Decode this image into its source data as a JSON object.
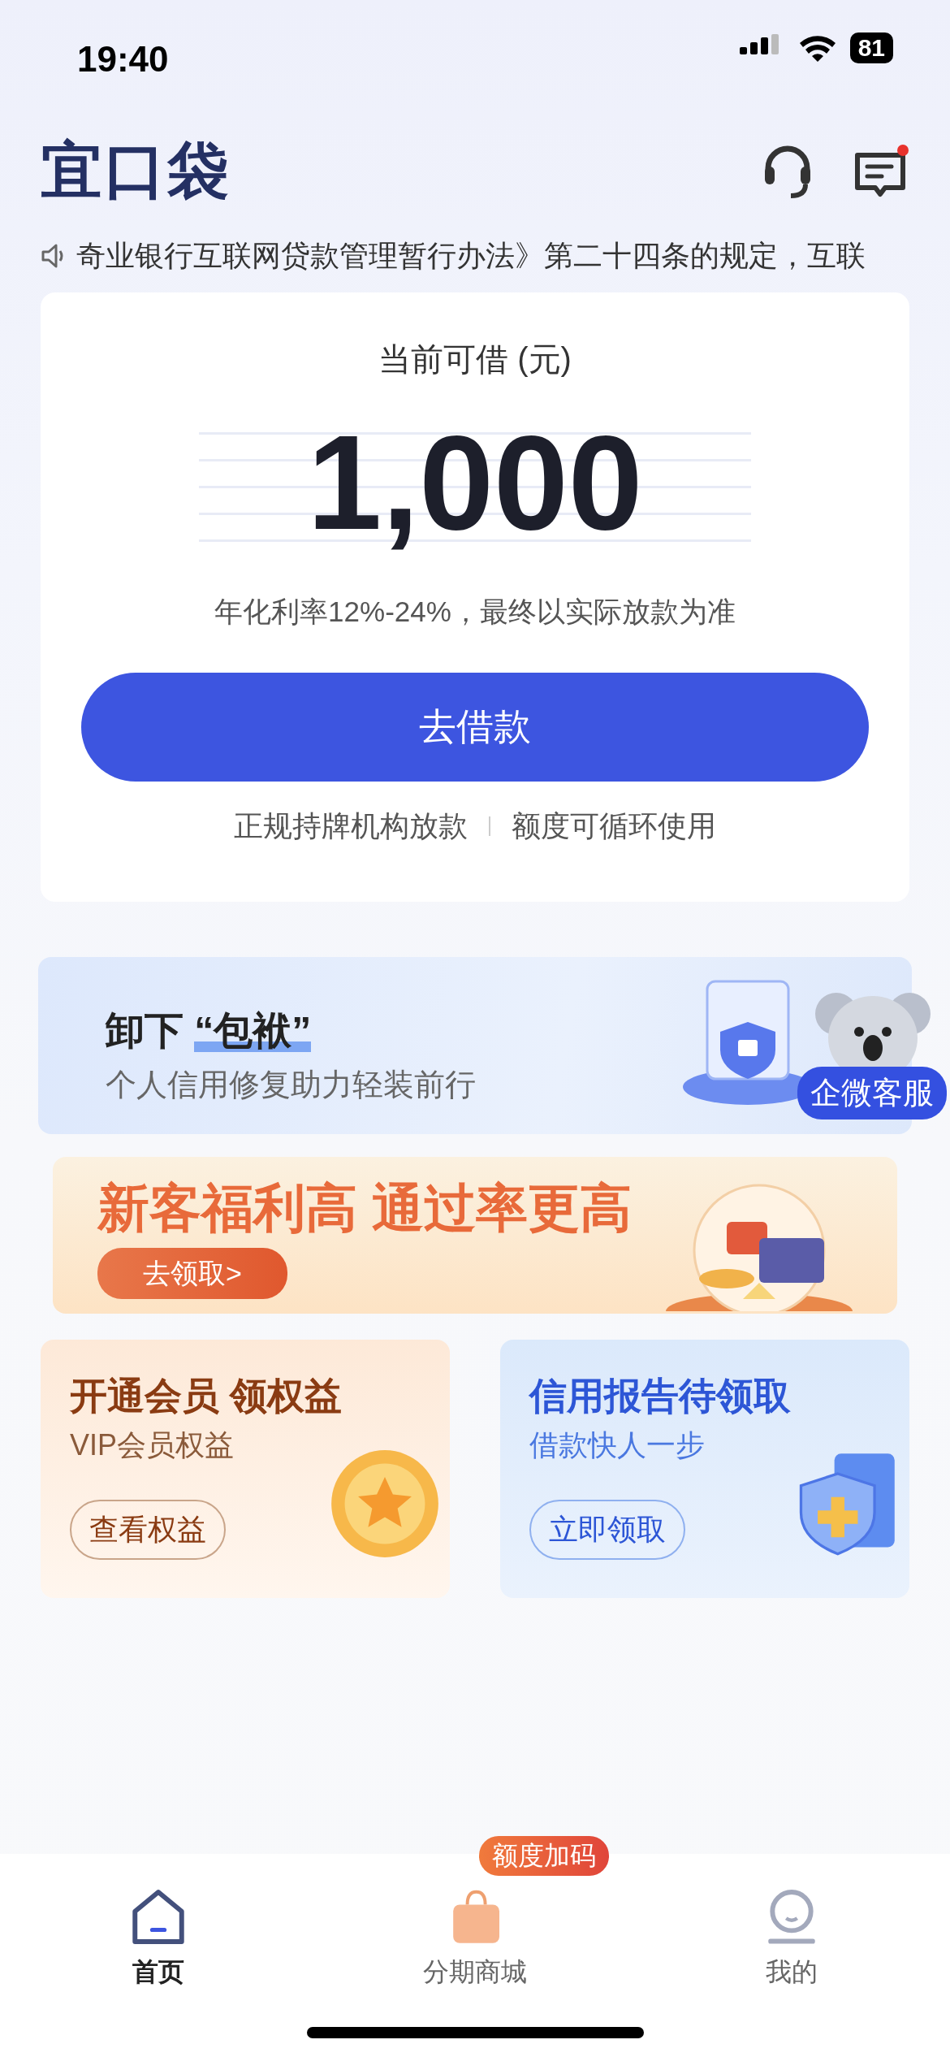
{
  "status_bar": {
    "time": "19:40",
    "battery": "81"
  },
  "header": {
    "logo": "宜口袋",
    "has_unread_messages": true
  },
  "notice": "奇业银行互联网贷款管理暂行办法》第二十四条的规定，互联",
  "loan_card": {
    "title": "当前可借 (元)",
    "amount": "1,000",
    "rate_note": "年化利率12%-24%，最终以实际放款为准",
    "button": "去借款",
    "features": [
      "正规持牌机构放款",
      "额度可循环使用"
    ]
  },
  "banners": [
    {
      "kind": "credit",
      "title_plain": "卸下",
      "title_highlight": "“包袱”",
      "subtitle": "个人信用修复助力轻装前行"
    },
    {
      "kind": "promo",
      "title": "新客福利高 通过率更高",
      "button": "去领取>"
    }
  ],
  "floating_service": "企微客服",
  "tiles": [
    {
      "kind": "vip",
      "title": "开通会员 领权益",
      "subtitle": "VIP会员权益",
      "button": "查看权益"
    },
    {
      "kind": "report",
      "title": "信用报告待领取",
      "subtitle": "借款快人一步",
      "button": "立即领取"
    }
  ],
  "tab_bar": [
    {
      "kind": "home",
      "label": "首页",
      "selected": true
    },
    {
      "kind": "mall",
      "label": "分期商城",
      "selected": false,
      "badge": "额度加码"
    },
    {
      "kind": "me",
      "label": "我的",
      "selected": false
    }
  ]
}
